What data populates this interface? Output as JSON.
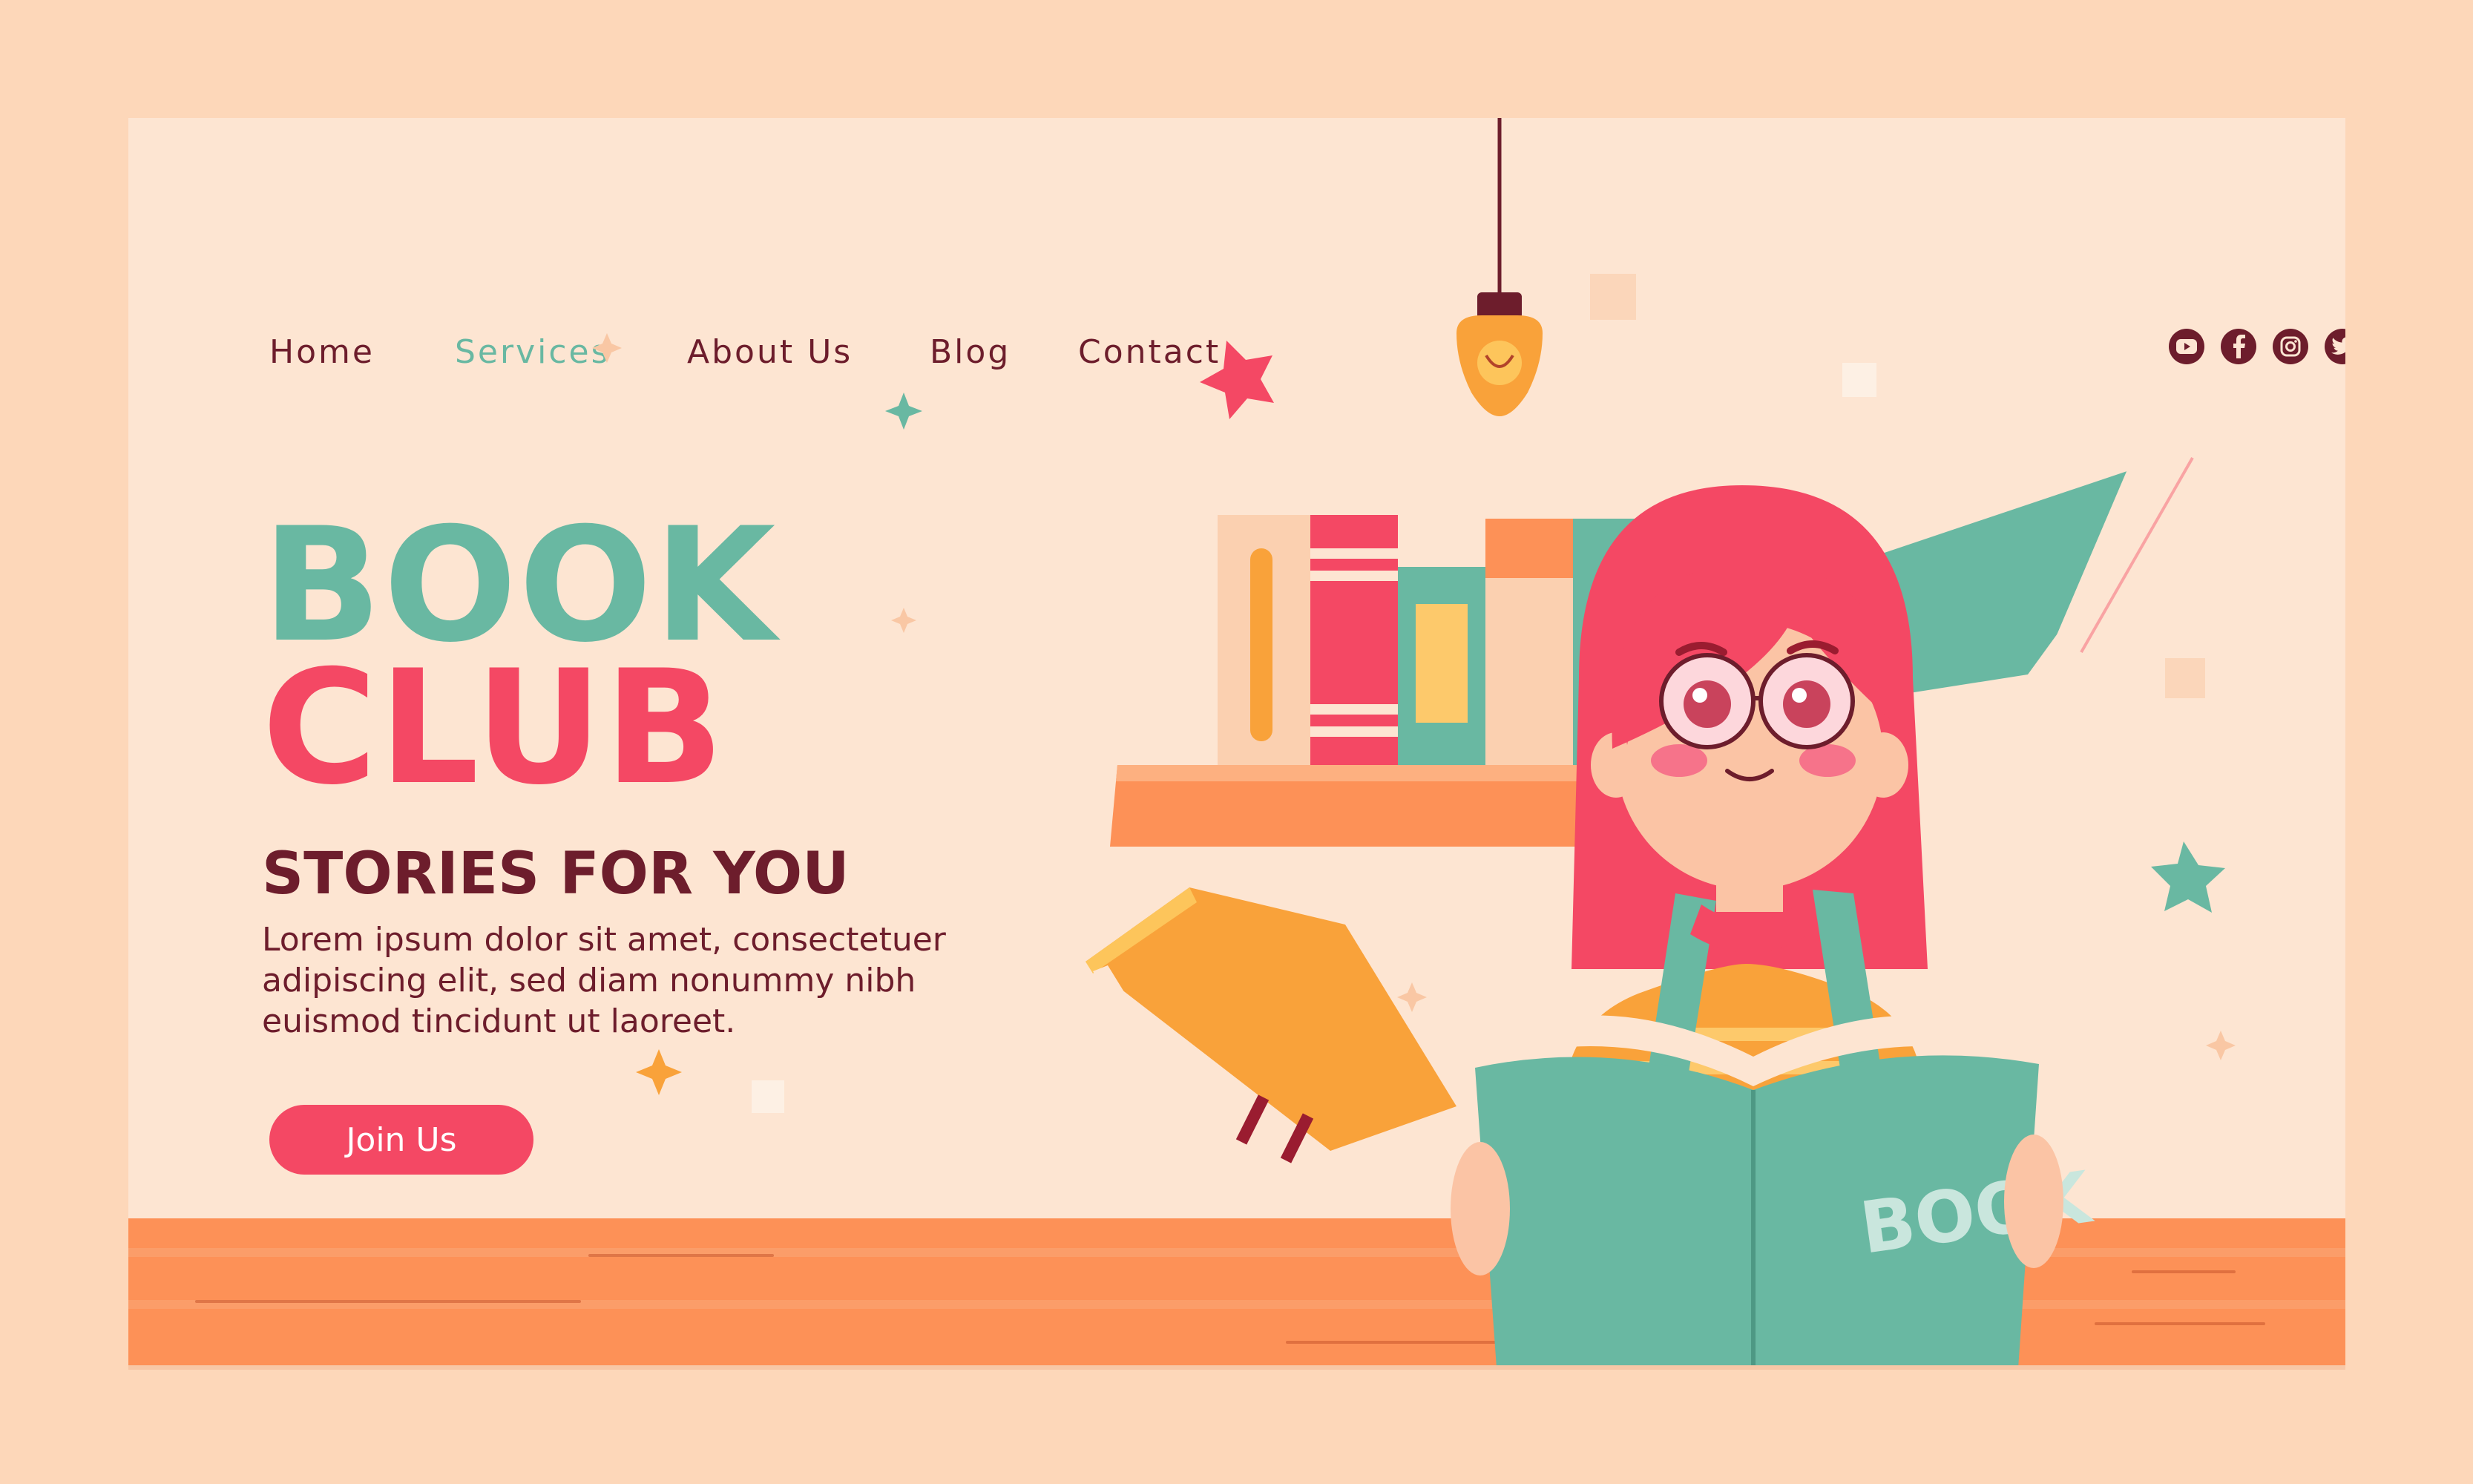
{
  "nav": {
    "items": [
      {
        "label": "Home",
        "active": false
      },
      {
        "label": "Services",
        "active": true
      },
      {
        "label": "About Us",
        "active": false
      },
      {
        "label": "Blog",
        "active": false
      },
      {
        "label": "Contact",
        "active": false
      }
    ]
  },
  "socials": [
    "youtube-icon",
    "facebook-icon",
    "instagram-icon",
    "twitter-icon"
  ],
  "hero": {
    "title_line1": "BOOK",
    "title_line2": "CLUB",
    "subtitle": "STORIES FOR YOU",
    "body": "Lorem ipsum dolor sit amet, consectetuer adipiscing elit, sed diam nonummy nibh euismod tincidunt ut laoreet.",
    "cta": "Join Us"
  },
  "illustration": {
    "book_cover_text": "BOOK"
  },
  "colors": {
    "page_bg": "#fdd7b9",
    "card_bg": "#fde5d2",
    "teal": "#69b8a2",
    "coral": "#f44864",
    "maroon": "#6d1d2c",
    "orange": "#fd9157"
  }
}
